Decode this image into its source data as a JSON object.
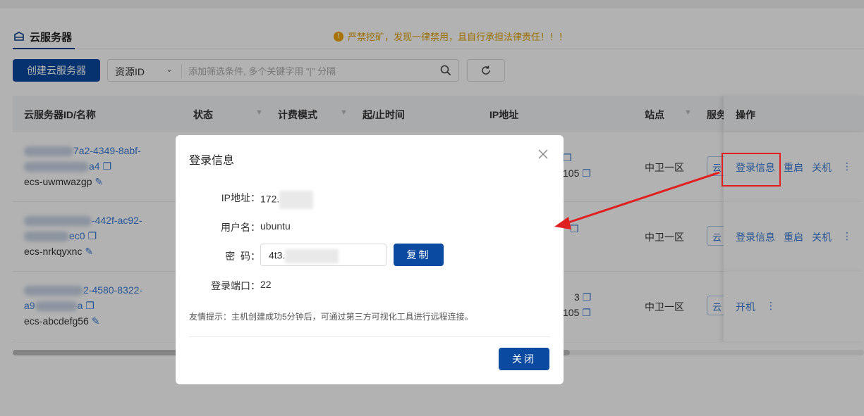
{
  "warning": "严禁挖矿，发现一律禁用，且自行承担法律责任！！！",
  "tab": {
    "label": "云服务器",
    "icon": "cloud-server-icon"
  },
  "toolbar": {
    "create_label": "创建云服务器",
    "filter_field": "资源ID",
    "filter_placeholder": "添加筛选条件, 多个关键字用 \"|\" 分隔"
  },
  "table": {
    "headers": [
      "云服务器ID/名称",
      "状态",
      "计费模式",
      "起/止时间",
      "IP地址",
      "站点",
      "服务",
      "操作"
    ],
    "rows": [
      {
        "id_part1": "7a2-4349-8abf-",
        "id_part2": "a4",
        "name": "ecs-uwmwazgp",
        "ip_suffix": "105",
        "site": "中卫一区",
        "svc": "云",
        "ops": [
          "登录信息",
          "重启",
          "关机"
        ]
      },
      {
        "id_part1": "-442f-ac92-",
        "id_part2": "ec0",
        "name": "ecs-nrkqyxnc",
        "site": "中卫一区",
        "svc": "云",
        "ops": [
          "登录信息",
          "重启",
          "关机"
        ]
      },
      {
        "id_part1": "2-4580-8322-",
        "id_part2": "a",
        "name": "ecs-abcdefg56",
        "ip_prefix": "3",
        "ip_suffix": "105",
        "site": "中卫一区",
        "svc": "云",
        "ops": [
          "开机"
        ]
      }
    ]
  },
  "modal": {
    "title": "登录信息",
    "ip_label": "IP地址：",
    "ip_value": "172.",
    "user_label": "用户名：",
    "user_value": "ubuntu",
    "pwd_label": "密  码：",
    "pwd_value": "4t3.",
    "copy_label": "复制",
    "port_label": "登录端口：",
    "port_value": "22",
    "tip": "友情提示：主机创建成功5分钟后，可通过第三方可视化工具进行远程连接。",
    "close_label": "关闭"
  },
  "colors": {
    "primary": "#0a4aa0",
    "link": "#3a7bd5",
    "warning": "#e0a000",
    "annotation": "#e02020"
  }
}
